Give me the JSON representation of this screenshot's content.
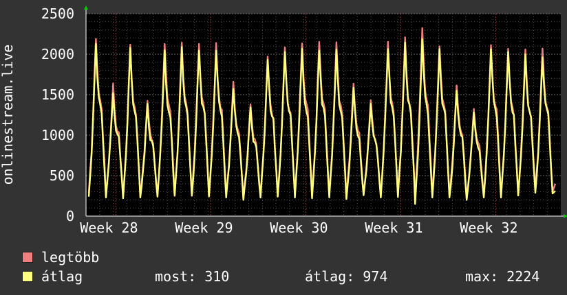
{
  "chart_data": {
    "type": "line",
    "title": "",
    "ylabel": "onlinestream.live",
    "xlabel": "",
    "ylim": [
      0,
      2500
    ],
    "yticks": [
      0,
      500,
      1000,
      1500,
      2000,
      2500
    ],
    "x_tick_labels": [
      "Week 28",
      "Week 29",
      "Week 30",
      "Week 31",
      "Week 32"
    ],
    "grid": true,
    "colors": {
      "background": "#333333",
      "plot": "#000000",
      "grid": "#555555",
      "max": "#f08080",
      "avg": "#ffff80"
    },
    "series": [
      {
        "name": "legtöbb",
        "color": "#f08080",
        "peaks": [
          2230,
          1640,
          2130,
          1440,
          2120,
          2150,
          2150,
          2140,
          1680,
          1420,
          2000,
          2080,
          2160,
          2170,
          2140,
          1660,
          1450,
          2160,
          2200,
          2320,
          2140,
          1640,
          1360,
          2150,
          2100,
          2050,
          2060
        ],
        "minimums": [
          260,
          250,
          240,
          240,
          260,
          250,
          250,
          240,
          250,
          210,
          250,
          250,
          250,
          240,
          250,
          230,
          260,
          250,
          250,
          240,
          250,
          240,
          220,
          250,
          250,
          260,
          300
        ],
        "last": 400
      },
      {
        "name": "átlag",
        "color": "#ffff80",
        "peaks": [
          2150,
          1560,
          2090,
          1370,
          2050,
          2100,
          2080,
          2080,
          1600,
          1380,
          1960,
          2040,
          2080,
          2090,
          2070,
          1580,
          1400,
          2100,
          2150,
          2200,
          2080,
          1580,
          1300,
          2080,
          2050,
          2000,
          2000
        ],
        "minimums": [
          240,
          230,
          220,
          230,
          240,
          230,
          230,
          220,
          230,
          200,
          230,
          230,
          230,
          220,
          230,
          210,
          240,
          230,
          230,
          150,
          230,
          220,
          200,
          230,
          230,
          240,
          280
        ],
        "last": 310
      }
    ]
  },
  "legend": {
    "max_label": "legtöbb",
    "avg_label": "átlag"
  },
  "stats": {
    "now_label": "most:",
    "now_value": "310",
    "avg_label": "átlag:",
    "avg_value": "974",
    "max_label": "max:",
    "max_value": "2224"
  }
}
